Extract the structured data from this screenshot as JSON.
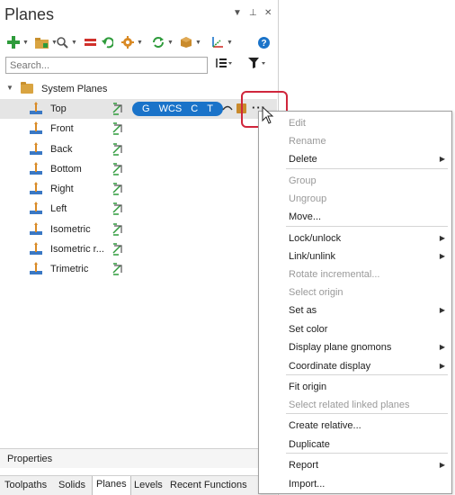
{
  "panel": {
    "title": "Planes",
    "controls": {
      "dropdown": "▼",
      "pin": "⊥",
      "close": "✕"
    }
  },
  "toolbar": {
    "buttons": [
      "add-icon",
      "folder-icon",
      "search-icon",
      "equals-icon",
      "undo-icon",
      "gear-icon",
      "refresh-icon",
      "cube-icon",
      "axis-icon",
      "help-icon"
    ]
  },
  "search": {
    "placeholder": "Search..."
  },
  "tree": {
    "group_label": "System Planes",
    "planes": [
      "Top",
      "Front",
      "Back",
      "Bottom",
      "Right",
      "Left",
      "Isometric",
      "Isometric r...",
      "Trimetric"
    ],
    "selected_badges": [
      "G",
      "WCS",
      "C",
      "T"
    ],
    "more_label": "···"
  },
  "properties": {
    "label": "Properties"
  },
  "tabs": [
    "Toolpaths",
    "Solids",
    "Planes",
    "Levels",
    "Recent Functions"
  ],
  "active_tab": "Planes",
  "context_menu": [
    {
      "label": "Edit",
      "disabled": true,
      "submenu": false
    },
    {
      "label": "Rename",
      "disabled": true,
      "submenu": false
    },
    {
      "label": "Delete",
      "disabled": false,
      "submenu": true
    },
    {
      "label": "Group",
      "disabled": true,
      "submenu": false
    },
    {
      "label": "Ungroup",
      "disabled": true,
      "submenu": false
    },
    {
      "label": "Move...",
      "disabled": false,
      "submenu": false
    },
    {
      "label": "Lock/unlock",
      "disabled": false,
      "submenu": true
    },
    {
      "label": "Link/unlink",
      "disabled": false,
      "submenu": true
    },
    {
      "label": "Rotate incremental...",
      "disabled": true,
      "submenu": false
    },
    {
      "label": "Select origin",
      "disabled": true,
      "submenu": false
    },
    {
      "label": "Set as",
      "disabled": false,
      "submenu": true
    },
    {
      "label": "Set color",
      "disabled": false,
      "submenu": false
    },
    {
      "label": "Display plane gnomons",
      "disabled": false,
      "submenu": true
    },
    {
      "label": "Coordinate display",
      "disabled": false,
      "submenu": true
    },
    {
      "label": "Fit origin",
      "disabled": false,
      "submenu": false
    },
    {
      "label": "Select related linked planes",
      "disabled": true,
      "submenu": false
    },
    {
      "label": "Create relative...",
      "disabled": false,
      "submenu": false
    },
    {
      "label": "Duplicate",
      "disabled": false,
      "submenu": false
    },
    {
      "label": "Report",
      "disabled": false,
      "submenu": true
    },
    {
      "label": "Import...",
      "disabled": false,
      "submenu": false
    }
  ],
  "colors": {
    "accent": "#1a73c9",
    "highlight": "#d0263c"
  }
}
